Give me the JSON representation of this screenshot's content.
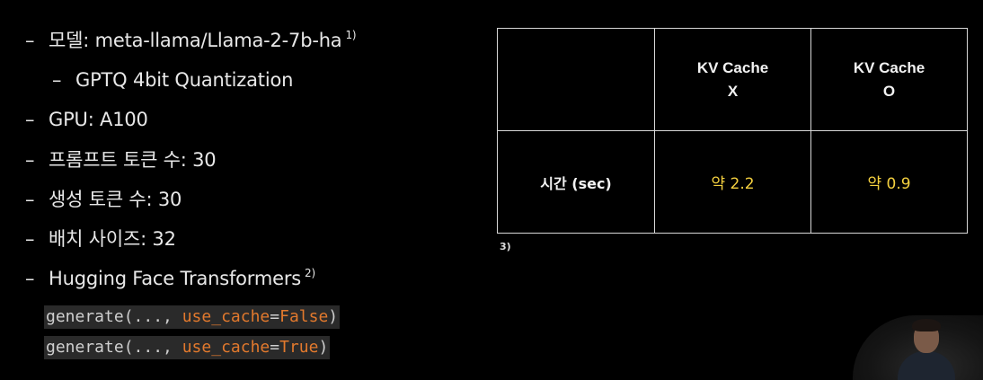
{
  "bullets": [
    {
      "text": "모델: meta-llama/Llama-2-7b-ha",
      "sup": "1)"
    },
    {
      "text": "GPTQ 4bit Quantization"
    },
    {
      "text": "GPU: A100"
    },
    {
      "text": "프롬프트 토큰 수: 30"
    },
    {
      "text": "생성 토큰 수: 30"
    },
    {
      "text": "배치 사이즈: 32"
    },
    {
      "text": "Hugging Face Transformers",
      "sup": "2)"
    }
  ],
  "dash": "–",
  "code_lines": [
    {
      "prefix": "generate(..., ",
      "param": "use_cache",
      "eq": "=",
      "value": "False",
      "suffix": ")"
    },
    {
      "prefix": "generate(..., ",
      "param": "use_cache",
      "eq": "=",
      "value": "True",
      "suffix": ")"
    }
  ],
  "table": {
    "headers": [
      {
        "line1": "KV Cache",
        "line2": "X"
      },
      {
        "line1": "KV Cache",
        "line2": "O"
      }
    ],
    "row_label": "시간 (sec)",
    "values": [
      "약 2.2",
      "약 0.9"
    ]
  },
  "footnote": "3)",
  "colors": {
    "value_highlight": "#f4d03f",
    "code_param": "#e2792d",
    "code_bg": "#2a2a2a"
  }
}
